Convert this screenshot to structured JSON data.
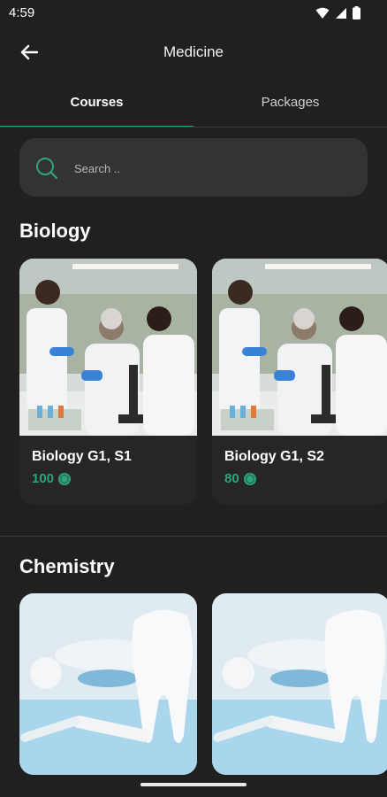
{
  "status_bar": {
    "time": "4:59"
  },
  "app_bar": {
    "title": "Medicine"
  },
  "tabs": [
    {
      "label": "Courses",
      "active": true
    },
    {
      "label": "Packages",
      "active": false
    }
  ],
  "search": {
    "placeholder": "Search .."
  },
  "sections": [
    {
      "title": "Biology",
      "courses": [
        {
          "title": "Biology G1, S1",
          "price": "100",
          "image": "lab-scientists-photo"
        },
        {
          "title": "Biology G1, S2",
          "price": "80",
          "image": "lab-scientists-photo"
        }
      ]
    },
    {
      "title": "Chemistry",
      "courses": [
        {
          "title": "",
          "price": "",
          "image": "tooth-dental-photo"
        },
        {
          "title": "",
          "price": "",
          "image": "tooth-dental-photo"
        }
      ]
    }
  ],
  "colors": {
    "background": "#202020",
    "accent": "#2fa37a",
    "card": "#262626",
    "search_bg": "#333333"
  }
}
